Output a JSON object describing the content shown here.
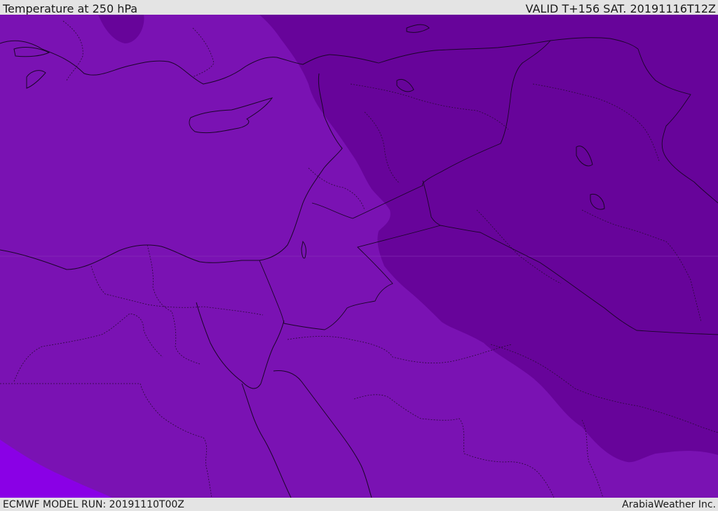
{
  "header": {
    "title": "Temperature at 250 hPa",
    "valid_time": "VALID T+156 SAT. 20191116T12Z"
  },
  "footer": {
    "model_run": "ECMWF MODEL RUN: 20191110T00Z",
    "credit": "ArabiaWeather Inc."
  },
  "colors": {
    "zone_west": "#7a12b3",
    "zone_east": "#67049a",
    "zone_southwest": "#8a00e6",
    "lines": "#1a0528"
  }
}
